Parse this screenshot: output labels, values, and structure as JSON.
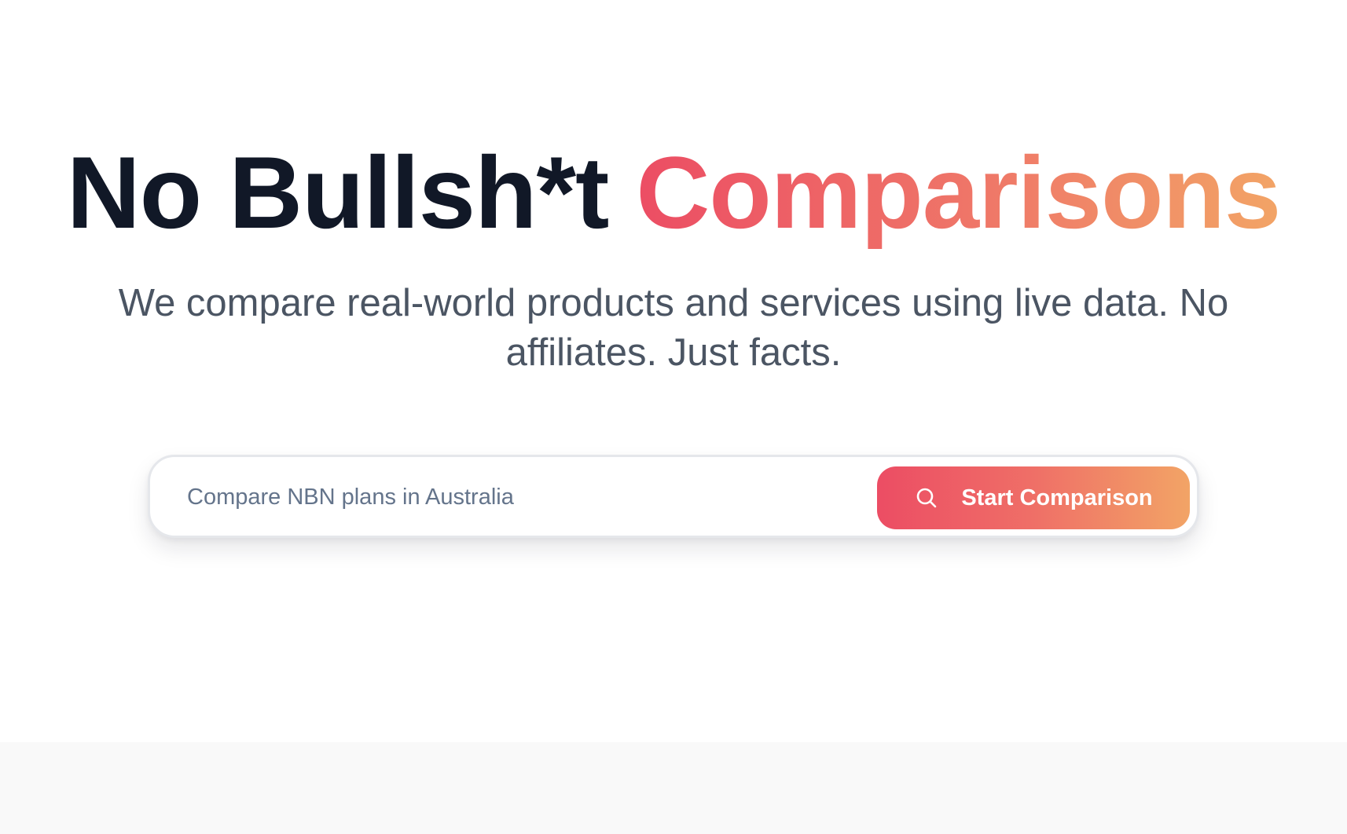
{
  "hero": {
    "headline_main": "No Bullsh*t",
    "headline_accent": "Comparisons",
    "subtitle": "We compare real-world products and services using live data. No affiliates. Just facts."
  },
  "search": {
    "value": "",
    "placeholder": "Compare NBN plans in Australia",
    "button_label": "Start Comparison",
    "button_icon": "search-icon"
  },
  "colors": {
    "headline": "#111827",
    "subtitle": "#4b5563",
    "accent_gradient_start": "#ec4d64",
    "accent_gradient_end": "#f2a466",
    "placeholder": "#64748b",
    "lower_section_background": "#f9f9f9"
  }
}
